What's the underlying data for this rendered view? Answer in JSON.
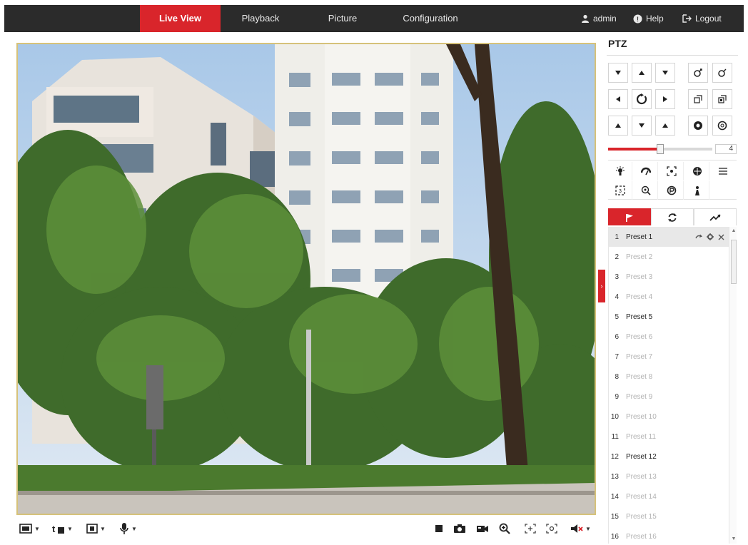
{
  "nav": {
    "tabs": [
      {
        "label": "Live View",
        "active": true
      },
      {
        "label": "Playback",
        "active": false
      },
      {
        "label": "Picture",
        "active": false
      },
      {
        "label": "Configuration",
        "active": false
      }
    ],
    "user": "admin",
    "help": "Help",
    "logout": "Logout"
  },
  "toolbar": {
    "left": [
      "window-layout-icon",
      "stream-type-icon",
      "plugin-type-icon",
      "microphone-icon"
    ],
    "right": [
      "stop-live-view-icon",
      "capture-icon",
      "record-icon",
      "digital-zoom-icon",
      "regional-focus-icon",
      "regional-exposure-icon",
      "audio-icon"
    ]
  },
  "ptz": {
    "title": "PTZ",
    "speed": "4",
    "speed_level": 0.5,
    "directions": [
      "up-left",
      "up",
      "up-right",
      "left",
      "auto-pan",
      "right",
      "down-left",
      "down",
      "down-right"
    ],
    "lens": [
      "zoom-in",
      "zoom-out",
      "focus-near",
      "focus-far",
      "iris-open",
      "iris-close"
    ],
    "functions": [
      "light",
      "wiper",
      "one-touch-focus",
      "lens-initialize",
      "more",
      "3d-positioning",
      "manual-tracking",
      "park",
      "auxiliary-focus"
    ],
    "tabs": [
      "preset-tab-icon",
      "patrol-tab-icon",
      "pattern-tab-icon"
    ],
    "presets": [
      {
        "num": "1",
        "name": "Preset 1",
        "set": true
      },
      {
        "num": "2",
        "name": "Preset 2",
        "set": false
      },
      {
        "num": "3",
        "name": "Preset 3",
        "set": false
      },
      {
        "num": "4",
        "name": "Preset 4",
        "set": false
      },
      {
        "num": "5",
        "name": "Preset 5",
        "set": true
      },
      {
        "num": "6",
        "name": "Preset 6",
        "set": false
      },
      {
        "num": "7",
        "name": "Preset 7",
        "set": false
      },
      {
        "num": "8",
        "name": "Preset 8",
        "set": false
      },
      {
        "num": "9",
        "name": "Preset 9",
        "set": false
      },
      {
        "num": "10",
        "name": "Preset 10",
        "set": false
      },
      {
        "num": "11",
        "name": "Preset 11",
        "set": false
      },
      {
        "num": "12",
        "name": "Preset 12",
        "set": true
      },
      {
        "num": "13",
        "name": "Preset 13",
        "set": false
      },
      {
        "num": "14",
        "name": "Preset 14",
        "set": false
      },
      {
        "num": "15",
        "name": "Preset 15",
        "set": false
      },
      {
        "num": "16",
        "name": "Preset 16",
        "set": false
      }
    ]
  },
  "colors": {
    "accent": "#d9252b",
    "topbar": "#2b2b2b",
    "video_border": "#d6c27a"
  }
}
